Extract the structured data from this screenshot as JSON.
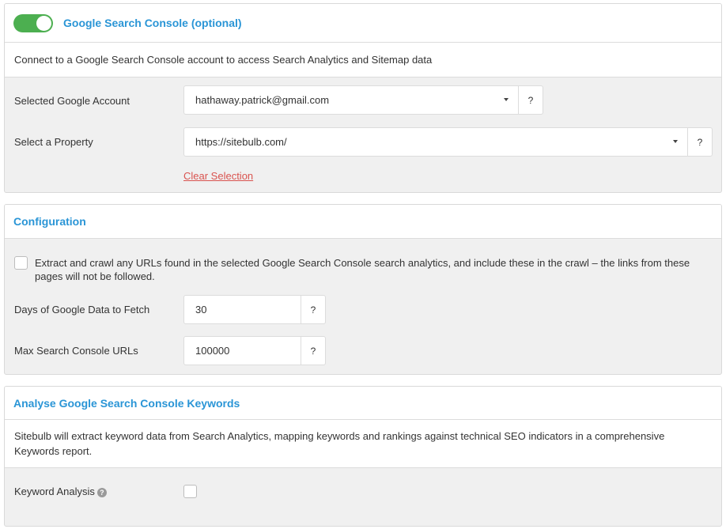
{
  "gsc": {
    "toggle_on": true,
    "title": "Google Search Console (optional)",
    "description": "Connect to a Google Search Console account to access Search Analytics and Sitemap data",
    "account_label": "Selected Google Account",
    "account_value": "hathaway.patrick@gmail.com",
    "property_label": "Select a Property",
    "property_value": "https://sitebulb.com/",
    "help_symbol": "?",
    "clear_link": "Clear Selection"
  },
  "configuration": {
    "title": "Configuration",
    "extract_checkbox_checked": false,
    "extract_text": "Extract and crawl any URLs found in the selected Google Search Console search analytics, and include these in the crawl – the links from these pages will not be followed.",
    "days_label": "Days of Google Data to Fetch",
    "days_value": "30",
    "max_label": "Max Search Console URLs",
    "max_value": "100000",
    "help_symbol": "?"
  },
  "keywords": {
    "title": "Analyse Google Search Console Keywords",
    "description": "Sitebulb will extract keyword data from Search Analytics, mapping keywords and rankings against technical SEO indicators in a comprehensive Keywords report.",
    "analysis_label": "Keyword Analysis",
    "analysis_help_icon": "?",
    "analysis_checked": false
  },
  "colors": {
    "accent": "#2a95d6",
    "toggle_on": "#4caf50",
    "link_red": "#d9534f",
    "panel_bg": "#f0f0f0"
  }
}
